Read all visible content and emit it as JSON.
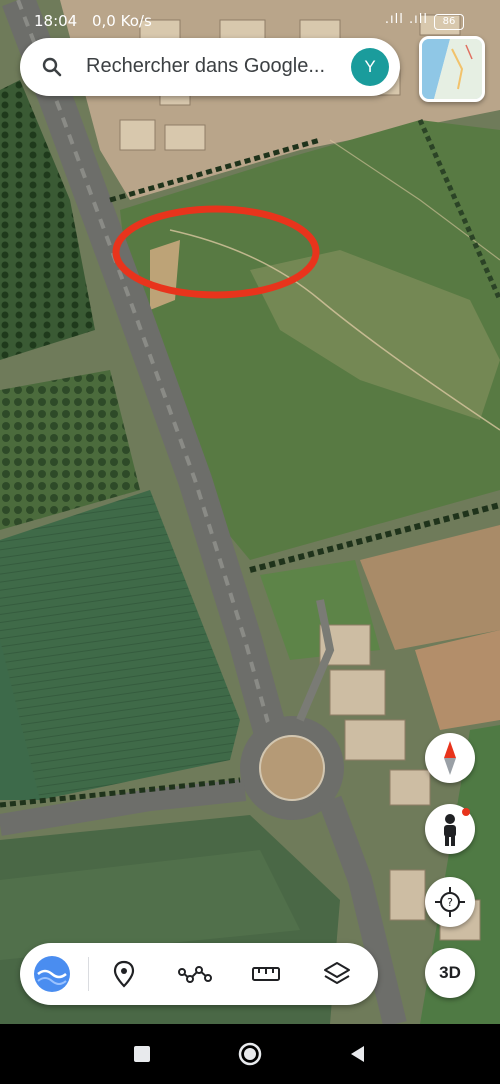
{
  "status_bar": {
    "time": "18:04",
    "network_speed": "0,0 Ko/s",
    "signal": ".ıll .ıll",
    "battery": "86"
  },
  "search": {
    "placeholder": "Rechercher dans Google...",
    "avatar_letter": "Y",
    "avatar_color": "#1a9c9c"
  },
  "map": {
    "layer": "satellite",
    "annotation_color": "#e8341c"
  },
  "side_controls": {
    "three_d_label": "3D"
  },
  "toolbar": {
    "items": [
      "voyager-icon",
      "pin-icon",
      "path-icon",
      "ruler-icon",
      "layers-icon"
    ]
  },
  "nav_bar": {
    "items": [
      "recents-icon",
      "home-icon",
      "back-icon"
    ]
  }
}
